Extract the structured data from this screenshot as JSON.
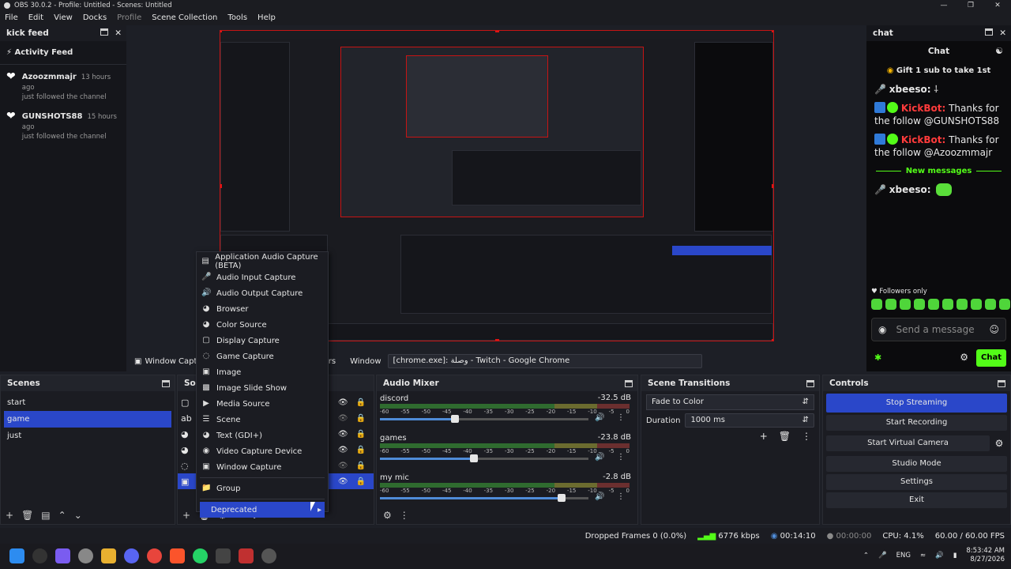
{
  "window": {
    "title": "OBS 30.0.2 - Profile: Untitled - Scenes: Untitled"
  },
  "menu": {
    "items": [
      "File",
      "Edit",
      "View",
      "Docks",
      "Profile",
      "Scene Collection",
      "Tools",
      "Help"
    ]
  },
  "kick_feed": {
    "dock_title": "kick feed",
    "title": "Activity Feed",
    "items": [
      {
        "name": "Azoozmmajr",
        "time": "13 hours ago",
        "action": "just followed the channel"
      },
      {
        "name": "GUNSHOTS88",
        "time": "15 hours ago",
        "action": "just followed the channel"
      }
    ]
  },
  "chat": {
    "dock_title": "chat",
    "header": "Chat",
    "pinned": "Gift 1 sub to take 1st",
    "messages": [
      {
        "user": "xbeeso:",
        "text": "⸸"
      },
      {
        "user": "KickBot:",
        "text": "Thanks for the follow @GUNSHOTS88"
      },
      {
        "user": "KickBot:",
        "text": "Thanks for the follow @Azoozmmajr"
      }
    ],
    "divider": "New messages",
    "last_message": {
      "user": "xbeeso:"
    },
    "followers_only": "Followers only",
    "input_placeholder": "Send a message",
    "send_label": "Chat"
  },
  "source_bar": {
    "window_capture": "Window Captu",
    "trailing": "rs",
    "window_label": "Window",
    "window_value": "[chrome.exe]: وصلة - Twitch - Google Chrome"
  },
  "scenes": {
    "title": "Scenes",
    "items": [
      "start",
      "game",
      "just"
    ],
    "selected_index": 1
  },
  "sources": {
    "title": "Sou"
  },
  "context_menu": {
    "items": [
      {
        "label": "Application Audio Capture (BETA)",
        "icon": "app-audio-icon"
      },
      {
        "label": "Audio Input Capture",
        "icon": "microphone-icon"
      },
      {
        "label": "Audio Output Capture",
        "icon": "speaker-icon"
      },
      {
        "label": "Browser",
        "icon": "globe-icon"
      },
      {
        "label": "Color Source",
        "icon": "palette-icon"
      },
      {
        "label": "Display Capture",
        "icon": "monitor-icon"
      },
      {
        "label": "Game Capture",
        "icon": "gamepad-icon"
      },
      {
        "label": "Image",
        "icon": "image-icon"
      },
      {
        "label": "Image Slide Show",
        "icon": "slideshow-icon"
      },
      {
        "label": "Media Source",
        "icon": "play-icon"
      },
      {
        "label": "Scene",
        "icon": "list-icon"
      },
      {
        "label": "Text (GDI+)",
        "icon": "text-icon"
      },
      {
        "label": "Video Capture Device",
        "icon": "camera-icon"
      },
      {
        "label": "Window Capture",
        "icon": "window-icon"
      }
    ],
    "group": "Group",
    "deprecated": "Deprecated"
  },
  "audio_mixer": {
    "title": "Audio Mixer",
    "ticks": [
      "-60",
      "-55",
      "-50",
      "-45",
      "-40",
      "-35",
      "-30",
      "-25",
      "-20",
      "-15",
      "-10",
      "-5",
      "0"
    ],
    "channels": [
      {
        "name": "discord",
        "db": "-32.5 dB",
        "level": 0.36
      },
      {
        "name": "games",
        "db": "-23.8 dB",
        "level": 0.45
      },
      {
        "name": "my mic",
        "db": "-2.8 dB",
        "level": 0.87
      }
    ]
  },
  "scene_transitions": {
    "title": "Scene Transitions",
    "transition": "Fade to Color",
    "duration_label": "Duration",
    "duration_value": "1000 ms"
  },
  "controls": {
    "title": "Controls",
    "buttons": [
      "Stop Streaming",
      "Start Recording",
      "Start Virtual Camera",
      "Studio Mode",
      "Settings",
      "Exit"
    ]
  },
  "status": {
    "dropped": "Dropped Frames 0 (0.0%)",
    "bitrate": "6776 kbps",
    "stream_time": "00:14:10",
    "rec_time": "00:00:00",
    "cpu": "CPU: 4.1%",
    "fps": "60.00 / 60.00 FPS"
  },
  "taskbar": {
    "lang": "ENG",
    "time": "8:53:42 AM",
    "date": "8/27/2026"
  },
  "colors": {
    "accent": "#2a47c9",
    "kick_green": "#53fc18",
    "preview_border": "#c71414"
  }
}
